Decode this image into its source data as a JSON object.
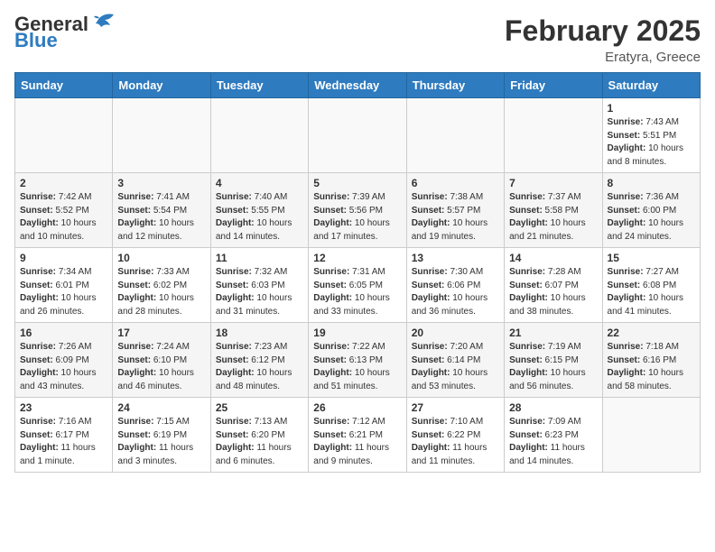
{
  "header": {
    "logo_general": "General",
    "logo_blue": "Blue",
    "month_year": "February 2025",
    "location": "Eratyra, Greece"
  },
  "days_of_week": [
    "Sunday",
    "Monday",
    "Tuesday",
    "Wednesday",
    "Thursday",
    "Friday",
    "Saturday"
  ],
  "weeks": [
    [
      null,
      null,
      null,
      null,
      null,
      null,
      {
        "day": "1",
        "sunrise": "7:43 AM",
        "sunset": "5:51 PM",
        "daylight": "10 hours and 8 minutes."
      }
    ],
    [
      {
        "day": "2",
        "sunrise": "7:42 AM",
        "sunset": "5:52 PM",
        "daylight": "10 hours and 10 minutes."
      },
      {
        "day": "3",
        "sunrise": "7:41 AM",
        "sunset": "5:54 PM",
        "daylight": "10 hours and 12 minutes."
      },
      {
        "day": "4",
        "sunrise": "7:40 AM",
        "sunset": "5:55 PM",
        "daylight": "10 hours and 14 minutes."
      },
      {
        "day": "5",
        "sunrise": "7:39 AM",
        "sunset": "5:56 PM",
        "daylight": "10 hours and 17 minutes."
      },
      {
        "day": "6",
        "sunrise": "7:38 AM",
        "sunset": "5:57 PM",
        "daylight": "10 hours and 19 minutes."
      },
      {
        "day": "7",
        "sunrise": "7:37 AM",
        "sunset": "5:58 PM",
        "daylight": "10 hours and 21 minutes."
      },
      {
        "day": "8",
        "sunrise": "7:36 AM",
        "sunset": "6:00 PM",
        "daylight": "10 hours and 24 minutes."
      }
    ],
    [
      {
        "day": "9",
        "sunrise": "7:34 AM",
        "sunset": "6:01 PM",
        "daylight": "10 hours and 26 minutes."
      },
      {
        "day": "10",
        "sunrise": "7:33 AM",
        "sunset": "6:02 PM",
        "daylight": "10 hours and 28 minutes."
      },
      {
        "day": "11",
        "sunrise": "7:32 AM",
        "sunset": "6:03 PM",
        "daylight": "10 hours and 31 minutes."
      },
      {
        "day": "12",
        "sunrise": "7:31 AM",
        "sunset": "6:05 PM",
        "daylight": "10 hours and 33 minutes."
      },
      {
        "day": "13",
        "sunrise": "7:30 AM",
        "sunset": "6:06 PM",
        "daylight": "10 hours and 36 minutes."
      },
      {
        "day": "14",
        "sunrise": "7:28 AM",
        "sunset": "6:07 PM",
        "daylight": "10 hours and 38 minutes."
      },
      {
        "day": "15",
        "sunrise": "7:27 AM",
        "sunset": "6:08 PM",
        "daylight": "10 hours and 41 minutes."
      }
    ],
    [
      {
        "day": "16",
        "sunrise": "7:26 AM",
        "sunset": "6:09 PM",
        "daylight": "10 hours and 43 minutes."
      },
      {
        "day": "17",
        "sunrise": "7:24 AM",
        "sunset": "6:10 PM",
        "daylight": "10 hours and 46 minutes."
      },
      {
        "day": "18",
        "sunrise": "7:23 AM",
        "sunset": "6:12 PM",
        "daylight": "10 hours and 48 minutes."
      },
      {
        "day": "19",
        "sunrise": "7:22 AM",
        "sunset": "6:13 PM",
        "daylight": "10 hours and 51 minutes."
      },
      {
        "day": "20",
        "sunrise": "7:20 AM",
        "sunset": "6:14 PM",
        "daylight": "10 hours and 53 minutes."
      },
      {
        "day": "21",
        "sunrise": "7:19 AM",
        "sunset": "6:15 PM",
        "daylight": "10 hours and 56 minutes."
      },
      {
        "day": "22",
        "sunrise": "7:18 AM",
        "sunset": "6:16 PM",
        "daylight": "10 hours and 58 minutes."
      }
    ],
    [
      {
        "day": "23",
        "sunrise": "7:16 AM",
        "sunset": "6:17 PM",
        "daylight": "11 hours and 1 minute."
      },
      {
        "day": "24",
        "sunrise": "7:15 AM",
        "sunset": "6:19 PM",
        "daylight": "11 hours and 3 minutes."
      },
      {
        "day": "25",
        "sunrise": "7:13 AM",
        "sunset": "6:20 PM",
        "daylight": "11 hours and 6 minutes."
      },
      {
        "day": "26",
        "sunrise": "7:12 AM",
        "sunset": "6:21 PM",
        "daylight": "11 hours and 9 minutes."
      },
      {
        "day": "27",
        "sunrise": "7:10 AM",
        "sunset": "6:22 PM",
        "daylight": "11 hours and 11 minutes."
      },
      {
        "day": "28",
        "sunrise": "7:09 AM",
        "sunset": "6:23 PM",
        "daylight": "11 hours and 14 minutes."
      },
      null
    ]
  ],
  "cell_labels": {
    "sunrise": "Sunrise:",
    "sunset": "Sunset:",
    "daylight": "Daylight:"
  }
}
